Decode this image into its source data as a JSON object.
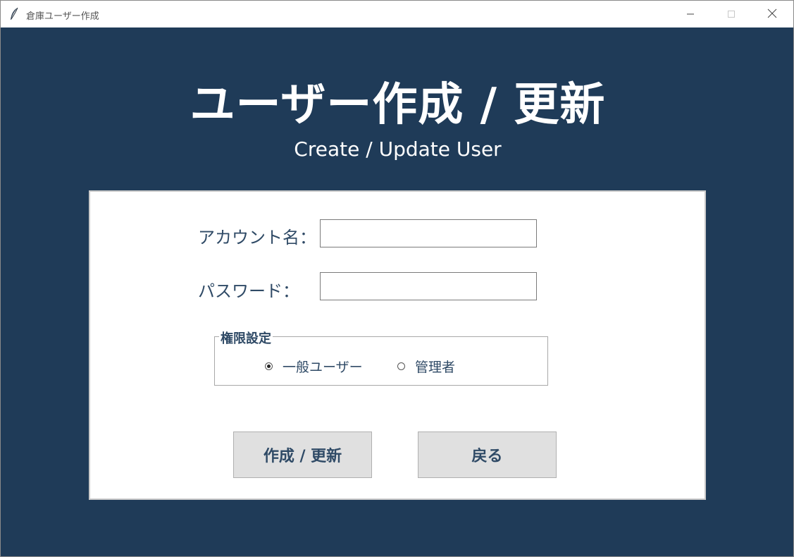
{
  "window": {
    "title": "倉庫ユーザー作成",
    "minimize_icon": "minimize-icon",
    "maximize_icon": "maximize-icon",
    "close_icon": "close-icon",
    "app_icon": "feather-icon"
  },
  "header": {
    "title": "ユーザー作成 / 更新",
    "subtitle": "Create / Update User"
  },
  "form": {
    "account_label": "アカウント名：",
    "account_value": "",
    "password_label": "パスワード：",
    "password_value": "",
    "permission": {
      "legend": "権限設定",
      "options": [
        {
          "label": "一般ユーザー",
          "checked": true
        },
        {
          "label": "管理者",
          "checked": false
        }
      ]
    }
  },
  "buttons": {
    "submit_label": "作成 / 更新",
    "back_label": "戻る"
  },
  "colors": {
    "background": "#1f3b58",
    "text_dark": "#2f4a66",
    "button_bg": "#e0e0e0"
  }
}
